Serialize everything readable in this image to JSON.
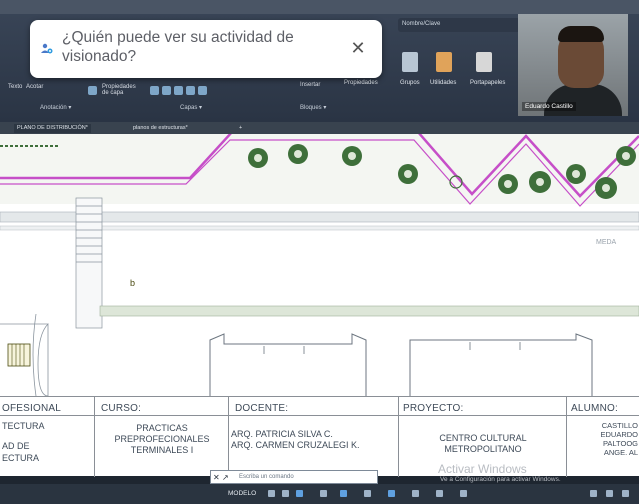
{
  "colors": {
    "accent_magenta": "#c64fc8",
    "autocad_ribbon": "#3a4658",
    "tree_green": "#3e6f3a",
    "popup_text": "#5d5f66",
    "title_block_text": "#3e4a58"
  },
  "privacy_popup": {
    "text": "¿Quién puede ver su actividad de visionado?",
    "close_symbol": "✕",
    "icon": "people-eye-icon"
  },
  "webcam": {
    "name": "Eduardo Castillo"
  },
  "ribbon": {
    "search_text": "Nombre/Clave",
    "left_labels": [
      "Texto",
      "Acotar",
      "Propiedades de capa"
    ],
    "group_annotation": "Anotación ▾",
    "group_layers": "Capas ▾",
    "group_blocks": "Bloques ▾",
    "big_tools": [
      "Propiedades",
      "Grupos",
      "Utilidades",
      "Portapapeles"
    ],
    "insert_label": "Insertar"
  },
  "tabs": [
    {
      "label": "PLANO DE DISTRIBUCIÓN*",
      "active": true
    },
    {
      "label": "planos de estructuras*",
      "active": false
    }
  ],
  "drawing": {
    "small_label": "b",
    "grid_label": "MEDA"
  },
  "title_block": {
    "col1": {
      "head": "OFESIONAL",
      "lines": [
        "TECTURA",
        "",
        "AD DE",
        "ECTURA"
      ]
    },
    "col2": {
      "head": "CURSO:",
      "lines": [
        "PRACTICAS",
        "PREPROFECIONALES",
        "TERMINALES I"
      ]
    },
    "col3": {
      "head": "DOCENTE:",
      "lines": [
        "ARQ. PATRICIA SILVA C.",
        "ARQ. CARMEN CRUZALEGI K."
      ]
    },
    "col4": {
      "head": "PROYECTO:",
      "lines": [
        "CENTRO CULTURAL",
        "METROPOLITANO"
      ]
    },
    "col5": {
      "head": "ALUMNO:",
      "lines": [
        "CASTILLO",
        "EDUARDO",
        "PALTOOG",
        "ANGE. AL"
      ]
    }
  },
  "watermark": {
    "line1": "Activar Windows",
    "line2": "Ve a Configuración para activar Windows."
  },
  "command_line": {
    "placeholder": "Escriba un comando"
  },
  "status_bar": {
    "model_label": "MODELO"
  }
}
